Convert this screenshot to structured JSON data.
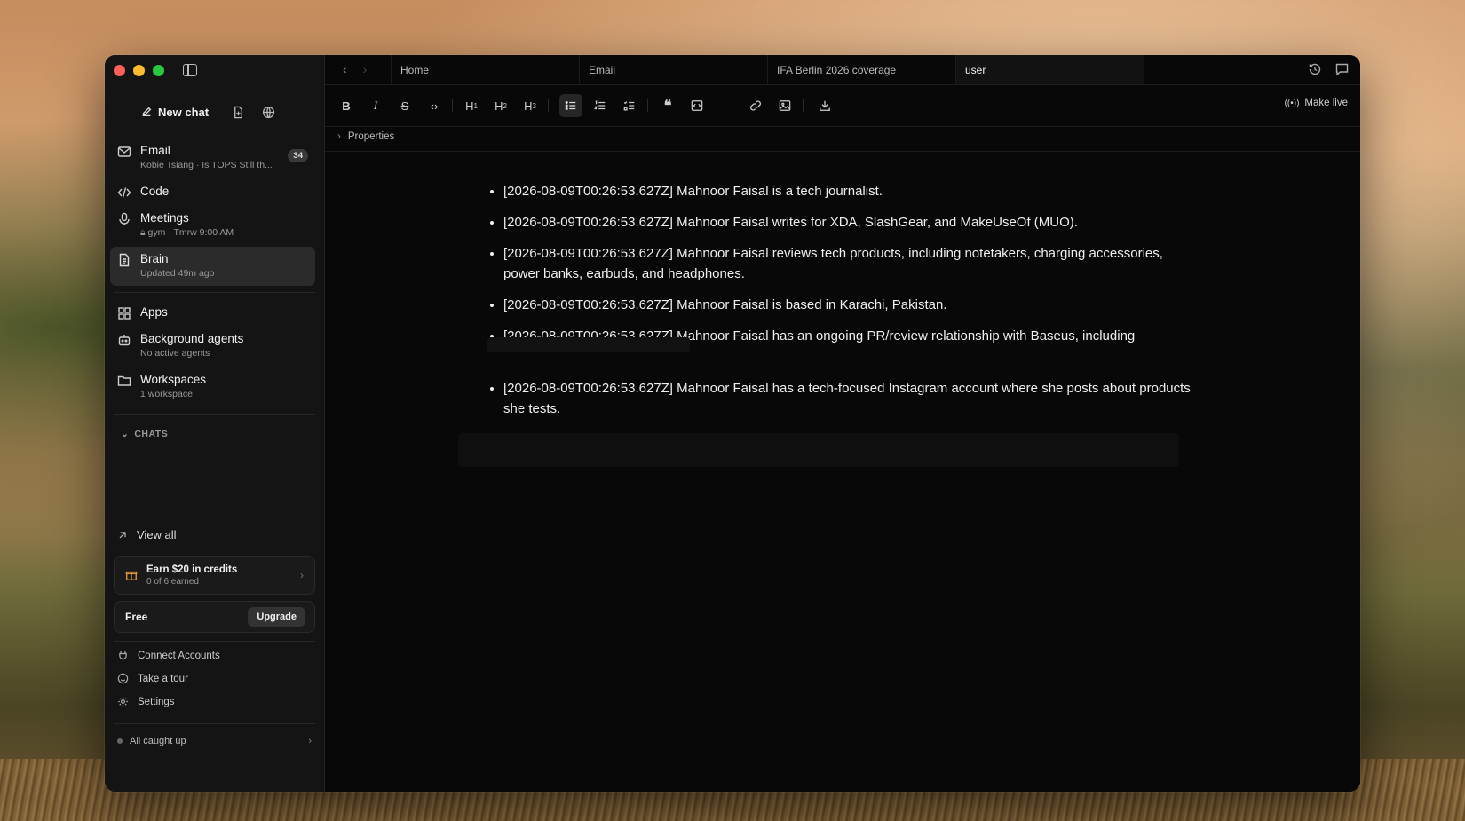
{
  "sidebar": {
    "new_chat": "New chat",
    "items": [
      {
        "title": "Email",
        "sub": "Kobie Tsiang · Is TOPS Still th...",
        "badge": "34"
      },
      {
        "title": "Code"
      },
      {
        "title": "Meetings",
        "sub": "gym · Tmrw 9:00 AM"
      },
      {
        "title": "Brain",
        "sub": "Updated 49m ago"
      },
      {
        "title": "Apps"
      },
      {
        "title": "Background agents",
        "sub": "No active agents"
      },
      {
        "title": "Workspaces",
        "sub": "1 workspace"
      }
    ],
    "chats_header": "CHATS",
    "view_all": "View all",
    "credits": {
      "title": "Earn $20 in credits",
      "sub": "0 of 6 earned"
    },
    "plan": {
      "name": "Free",
      "upgrade": "Upgrade"
    },
    "footer": [
      "Connect Accounts",
      "Take a tour",
      "Settings"
    ],
    "status": "All caught up"
  },
  "tabs": [
    "Home",
    "Email",
    "IFA Berlin 2026 coverage",
    "user"
  ],
  "toolbar": {
    "make_live": "Make live",
    "h1": "H",
    "h2": "H",
    "h3": "H",
    "h1s": "1",
    "h2s": "2",
    "h3s": "3"
  },
  "properties_label": "Properties",
  "notes": [
    "[2026-08-09T00:26:53.627Z] Mahnoor Faisal is a tech journalist.",
    "[2026-08-09T00:26:53.627Z] Mahnoor Faisal writes for XDA, SlashGear, and MakeUseOf (MUO).",
    "[2026-08-09T00:26:53.627Z] Mahnoor Faisal reviews tech products, including notetakers, charging accessories, power banks, earbuds, and headphones.",
    "[2026-08-09T00:26:53.627Z] Mahnoor Faisal is based in Karachi, Pakistan.",
    "[2026-08-09T00:26:53.627Z] Mahnoor Faisal has an ongoing PR/review relationship with Baseus, including",
    "[2026-08-09T00:26:53.627Z] Mahnoor Faisal has a tech-focused Instagram account where she posts about products she tests."
  ]
}
